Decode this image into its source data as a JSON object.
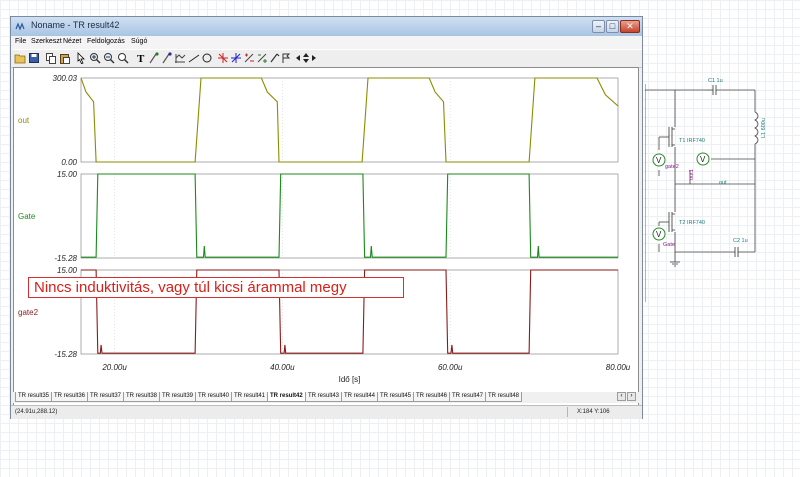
{
  "window": {
    "title": "Noname - TR result42",
    "controls": {
      "minimize": "–",
      "maximize": "□",
      "close": "✕"
    }
  },
  "menu": [
    "File",
    "Szerkeszt",
    "Nézet",
    "Feldolgozás",
    "Súgó"
  ],
  "toolbar": {
    "icons": [
      "open-folder-icon",
      "save-icon",
      "copy-icon",
      "paste-icon",
      "pointer-icon",
      "zoom-in-icon",
      "zoom-out-icon",
      "zoom-fit-icon",
      "text-icon",
      "cursor-a-icon",
      "cursor-b-icon",
      "axis-icon",
      "line-icon",
      "circle-icon",
      "marker-a-icon",
      "marker-b-icon",
      "marker-c-icon",
      "marker-d-icon",
      "marker-e-icon",
      "nav-left-icon",
      "nav-updown-icon",
      "nav-right-icon"
    ]
  },
  "annotation": "Nincs induktivitás, vagy túl kicsi árammal megy",
  "chart_data": {
    "type": "line",
    "xlabel": "Idő [s]",
    "xlim": [
      16,
      80
    ],
    "x_ticks": [
      "20.00u",
      "40.00u",
      "60.00u",
      "80.00u"
    ],
    "x_tick_values": [
      20,
      40,
      60,
      80
    ],
    "panels": [
      {
        "name": "out",
        "color": "#8c8c00",
        "ylim": [
          0,
          300.03
        ],
        "ytick_labels": [
          "300.03",
          "0.00"
        ],
        "points": [
          [
            16,
            300
          ],
          [
            16.6,
            250
          ],
          [
            17.5,
            215
          ],
          [
            17.8,
            0
          ],
          [
            29.6,
            0
          ],
          [
            30.3,
            300
          ],
          [
            37.5,
            300
          ],
          [
            38.2,
            250
          ],
          [
            39.4,
            215
          ],
          [
            39.6,
            0
          ],
          [
            49.5,
            0
          ],
          [
            50.2,
            300
          ],
          [
            57.5,
            300
          ],
          [
            58.2,
            250
          ],
          [
            59.2,
            215
          ],
          [
            59.5,
            0
          ],
          [
            69.4,
            0
          ],
          [
            70.1,
            300
          ],
          [
            77.5,
            300
          ],
          [
            78.5,
            240
          ],
          [
            80,
            200
          ]
        ]
      },
      {
        "name": "Gate",
        "color": "#1a8a1a",
        "ylim": [
          -15.28,
          15.0
        ],
        "ytick_labels": [
          "15.00",
          "-15.28"
        ],
        "points": [
          [
            16,
            -15
          ],
          [
            17.8,
            -15
          ],
          [
            18,
            15
          ],
          [
            29.6,
            15
          ],
          [
            29.8,
            -15
          ],
          [
            30.6,
            -15
          ],
          [
            30.7,
            -11
          ],
          [
            30.8,
            -15
          ],
          [
            39.6,
            -15
          ],
          [
            39.8,
            15
          ],
          [
            49.6,
            15
          ],
          [
            49.8,
            -15
          ],
          [
            50.5,
            -15
          ],
          [
            50.6,
            -11
          ],
          [
            50.7,
            -15
          ],
          [
            59.5,
            -15
          ],
          [
            59.7,
            15
          ],
          [
            69.4,
            15
          ],
          [
            69.6,
            -15
          ],
          [
            70.4,
            -15
          ],
          [
            70.5,
            -11
          ],
          [
            70.6,
            -15
          ],
          [
            80,
            -15
          ]
        ]
      },
      {
        "name": "gate2",
        "color": "#8b1a1a",
        "ylim": [
          -15.28,
          15.0
        ],
        "ytick_labels": [
          "15.00",
          "-15.28"
        ],
        "points": [
          [
            16,
            15
          ],
          [
            17.8,
            15
          ],
          [
            18,
            -15
          ],
          [
            18.3,
            -15
          ],
          [
            18.4,
            -12
          ],
          [
            18.5,
            -15
          ],
          [
            29.6,
            -15
          ],
          [
            29.8,
            15
          ],
          [
            39.6,
            15
          ],
          [
            39.8,
            -15
          ],
          [
            40.2,
            -15
          ],
          [
            40.3,
            -12
          ],
          [
            40.4,
            -15
          ],
          [
            49.6,
            -15
          ],
          [
            49.8,
            15
          ],
          [
            59.5,
            15
          ],
          [
            59.7,
            -15
          ],
          [
            60.1,
            -15
          ],
          [
            60.2,
            -12
          ],
          [
            60.3,
            -15
          ],
          [
            69.4,
            -15
          ],
          [
            69.6,
            15
          ],
          [
            80,
            15
          ]
        ]
      }
    ]
  },
  "tabs": {
    "items": [
      "TR result35",
      "TR result36",
      "TR result37",
      "TR result38",
      "TR result39",
      "TR result40",
      "TR result41",
      "TR result42",
      "TR result43",
      "TR result44",
      "TR result45",
      "TR result46",
      "TR result47",
      "TR result48"
    ],
    "active": "TR result42"
  },
  "status": {
    "coords": "(24.91u,288.12)",
    "cursor": "X:184  Y:106"
  },
  "schematic": {
    "labels": {
      "c1": "C1 1u",
      "l1": "L1 600u",
      "t1": "T1 IRF740",
      "t2": "T2 IRF740",
      "c2": "C2 1u",
      "gate2": "gate2",
      "gate": "Gate",
      "out": "out",
      "out_probe": "out1",
      "meter": "V"
    }
  }
}
